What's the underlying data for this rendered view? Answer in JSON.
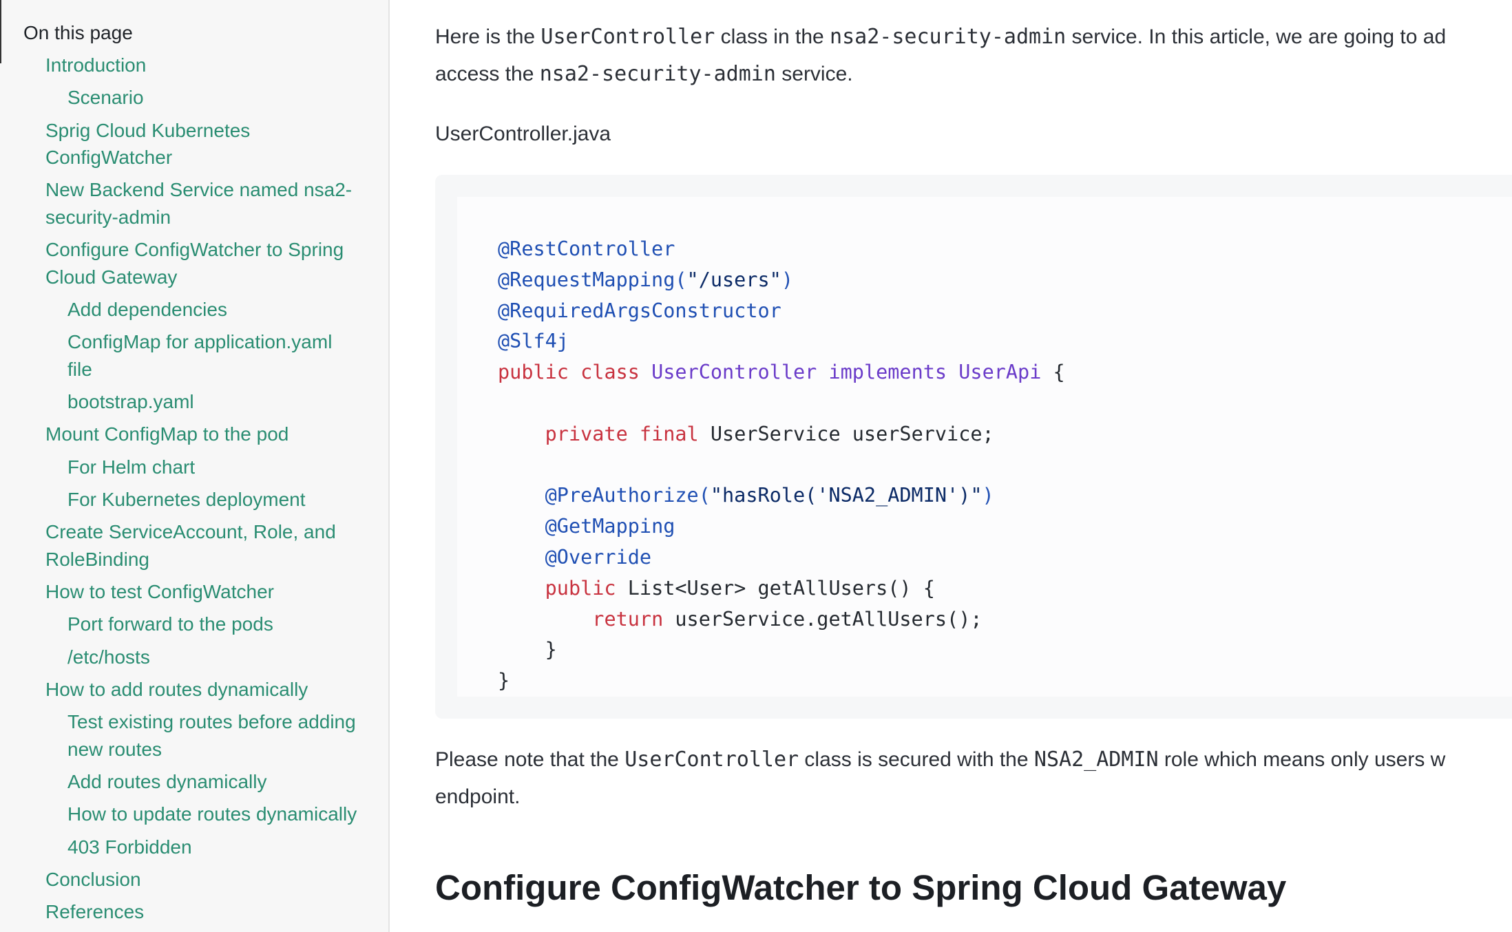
{
  "sidebar": {
    "heading": "On this page",
    "items": [
      {
        "label": "Introduction",
        "level": 1
      },
      {
        "label": "Scenario",
        "level": 2
      },
      {
        "label": "Sprig Cloud Kubernetes ConfigWatcher",
        "level": 1
      },
      {
        "label": "New Backend Service named nsa2-security-admin",
        "level": 1
      },
      {
        "label": "Configure ConfigWatcher to Spring Cloud Gateway",
        "level": 1
      },
      {
        "label": "Add dependencies",
        "level": 2
      },
      {
        "label": "ConfigMap for application.yaml file",
        "level": 2
      },
      {
        "label": "bootstrap.yaml",
        "level": 2
      },
      {
        "label": "Mount ConfigMap to the pod",
        "level": 1
      },
      {
        "label": "For Helm chart",
        "level": 2
      },
      {
        "label": "For Kubernetes deployment",
        "level": 2
      },
      {
        "label": "Create ServiceAccount, Role, and RoleBinding",
        "level": 1
      },
      {
        "label": "How to test ConfigWatcher",
        "level": 1
      },
      {
        "label": "Port forward to the pods",
        "level": 2
      },
      {
        "label": "/etc/hosts",
        "level": 2
      },
      {
        "label": "How to add routes dynamically",
        "level": 1
      },
      {
        "label": "Test existing routes before adding new routes",
        "level": 2
      },
      {
        "label": "Add routes dynamically",
        "level": 2
      },
      {
        "label": "How to update routes dynamically",
        "level": 2
      },
      {
        "label": "403 Forbidden",
        "level": 2
      },
      {
        "label": "Conclusion",
        "level": 1
      },
      {
        "label": "References",
        "level": 1
      }
    ]
  },
  "content": {
    "intro_line1": {
      "t1": "Here is the ",
      "c1": "UserController",
      "t2": " class in the ",
      "c2": "nsa2-security-admin",
      "t3": " service. In this article, we are going to ad"
    },
    "intro_line2": {
      "t1": "access the ",
      "c1": "nsa2-security-admin",
      "t2": " service."
    },
    "filename": "UserController.java",
    "code_lines": [
      [
        [
          "ann",
          "@RestController"
        ]
      ],
      [
        [
          "ann",
          "@RequestMapping("
        ],
        [
          "str",
          "\"/users\""
        ],
        [
          "ann",
          ")"
        ]
      ],
      [
        [
          "ann",
          "@RequiredArgsConstructor"
        ]
      ],
      [
        [
          "ann",
          "@Slf4j"
        ]
      ],
      [
        [
          "kw",
          "public"
        ],
        [
          "plain",
          " "
        ],
        [
          "kw",
          "class"
        ],
        [
          "plain",
          " "
        ],
        [
          "type",
          "UserController"
        ],
        [
          "plain",
          " "
        ],
        [
          "type",
          "implements"
        ],
        [
          "plain",
          " "
        ],
        [
          "type",
          "UserApi"
        ],
        [
          "plain",
          " {"
        ]
      ],
      [
        [
          "plain",
          ""
        ]
      ],
      [
        [
          "plain",
          "    "
        ],
        [
          "kw",
          "private"
        ],
        [
          "plain",
          " "
        ],
        [
          "kw",
          "final"
        ],
        [
          "plain",
          " UserService userService;"
        ]
      ],
      [
        [
          "plain",
          ""
        ]
      ],
      [
        [
          "plain",
          "    "
        ],
        [
          "ann",
          "@PreAuthorize("
        ],
        [
          "str",
          "\"hasRole('NSA2_ADMIN')\""
        ],
        [
          "ann",
          ")"
        ]
      ],
      [
        [
          "plain",
          "    "
        ],
        [
          "ann",
          "@GetMapping"
        ]
      ],
      [
        [
          "plain",
          "    "
        ],
        [
          "ann",
          "@Override"
        ]
      ],
      [
        [
          "plain",
          "    "
        ],
        [
          "kw",
          "public"
        ],
        [
          "plain",
          " List<User> getAllUsers() {"
        ]
      ],
      [
        [
          "plain",
          "        "
        ],
        [
          "kw",
          "return"
        ],
        [
          "plain",
          " userService.getAllUsers();"
        ]
      ],
      [
        [
          "plain",
          "    }"
        ]
      ],
      [
        [
          "plain",
          "}"
        ]
      ]
    ],
    "note_line1": {
      "t1": "Please note that the ",
      "c1": "UserController",
      "t2": " class is secured with the ",
      "c2": "NSA2_ADMIN",
      "t3": " role which means only users w"
    },
    "note_line2": "endpoint.",
    "section_heading": "Configure ConfigWatcher to Spring Cloud Gateway"
  },
  "colors": {
    "link": "#2a8d72",
    "annotation": "#1f4fb3",
    "keyword": "#c8323f",
    "type": "#6a3bc9",
    "string": "#0b2a66"
  }
}
